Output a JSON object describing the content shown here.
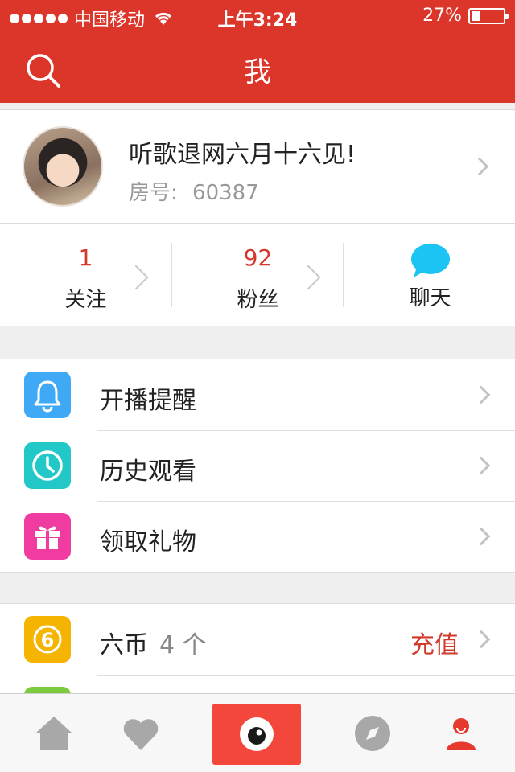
{
  "status_bar": {
    "carrier": "中国移动",
    "time": "上午3:24",
    "battery": "27%",
    "battery_level": 0.27
  },
  "nav": {
    "title": "我"
  },
  "profile": {
    "name": "听歌退网六月十六见!",
    "room_label": "房号:",
    "room_number": "60387"
  },
  "stats": [
    {
      "value": "1",
      "label": "关注"
    },
    {
      "value": "92",
      "label": "粉丝"
    },
    {
      "label": "聊天"
    }
  ],
  "menu_group_1": [
    {
      "label": "开播提醒",
      "icon": "bell-icon",
      "color": "#3fa9f5"
    },
    {
      "label": "历史观看",
      "icon": "clock-icon",
      "color": "#22c8c8"
    },
    {
      "label": "领取礼物",
      "icon": "gift-icon",
      "color": "#f03ca0"
    }
  ],
  "menu_group_2": {
    "coin_label": "六币",
    "coin_count": "4 个",
    "recharge_label": "充值",
    "coin_color": "#f5b400"
  },
  "tabbar": [
    "home-icon",
    "heart-icon",
    "live-eye-icon",
    "compass-icon",
    "profile-icon"
  ],
  "colors": {
    "brand_red": "#dc352a",
    "accent_red": "#d0392b",
    "chat_blue": "#1cc4f4"
  }
}
